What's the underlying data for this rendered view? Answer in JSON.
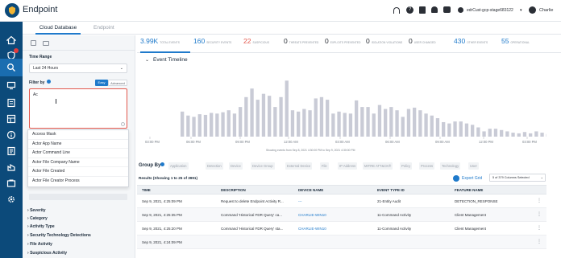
{
  "app": {
    "title": "Endpoint",
    "tenant": "edrCust-gcp-stage683122",
    "user": "Charlie"
  },
  "tabs": [
    {
      "label": "Cloud Database"
    },
    {
      "label": "Endpoint"
    }
  ],
  "sidebar": {
    "time_range_label": "Time Range",
    "time_range_value": "Last 24 Hours",
    "filter_by_label": "Filter by",
    "mode_easy": "Easy",
    "mode_advanced": "Advanced",
    "filter_text": "Ac",
    "dropdown_items": [
      "Access Mask",
      "Actor App Name",
      "Actor Command Line",
      "Actor File Company Name",
      "Actor File Created",
      "Actor File Creator Process"
    ],
    "sections": [
      "Severity",
      "Category",
      "Activity Type",
      "Security Technology Detections",
      "File Activity",
      "Suspicious Activity"
    ]
  },
  "stats": [
    {
      "value": "3.99K",
      "label": "Total Events",
      "color": "#1f7acb"
    },
    {
      "value": "160",
      "label": "Security Events",
      "color": "#1f7acb"
    },
    {
      "value": "22",
      "label": "Suspicious",
      "color": "#e2574c"
    },
    {
      "value": "0",
      "label": "Threats Prevented",
      "color": "#2b2f36"
    },
    {
      "value": "0",
      "label": "Exploits Prevented",
      "color": "#2b2f36"
    },
    {
      "value": "0",
      "label": "Isolation Violations",
      "color": "#2b2f36"
    },
    {
      "value": "0",
      "label": "User Changed",
      "color": "#2b2f36"
    },
    {
      "value": "430",
      "label": "Other Events",
      "color": "#1f7acb"
    },
    {
      "value": "55",
      "label": "Operational",
      "color": "#1f7acb"
    }
  ],
  "timeline": {
    "title": "Event Timeline",
    "caption": "Showing events from Sep 8, 2021 4:30:00 PM to Sep 9, 2021 4:30:00 PM",
    "tick_labels": [
      "03:00 PM",
      "06:00 PM",
      "09:00 PM",
      "12:00 AM",
      "03:00 AM",
      "06:00 AM",
      "09:00 AM",
      "12:00 PM",
      "03:00 PM"
    ],
    "bars": [
      0.38,
      0.32,
      0.3,
      0.34,
      0.33,
      0.36,
      0.35,
      0.37,
      0.4,
      0.35,
      0.45,
      0.6,
      0.73,
      0.56,
      0.65,
      0.62,
      0.45,
      0.6,
      0.85,
      0.4,
      0.38,
      0.42,
      0.4,
      0.58,
      0.6,
      0.56,
      0.35,
      0.38,
      0.36,
      0.35,
      0.55,
      0.45,
      0.45,
      0.35,
      0.48,
      0.42,
      0.45,
      0.4,
      0.3,
      0.42,
      0.44,
      0.4,
      0.35,
      0.32,
      0.28,
      0.22,
      0.2,
      0.23,
      0.23,
      0.2,
      0.18,
      0.14,
      0.08,
      0.12,
      0.12,
      0.1,
      0.08,
      0.06,
      0.05,
      0.07,
      0.05,
      0.08,
      0.06,
      0.04,
      0.05
    ]
  },
  "group_by": {
    "label": "Group By",
    "options": [
      "Application",
      "Detection",
      "Device",
      "Device Group",
      "External Device",
      "File",
      "IP Address",
      "MITRE ATT&CK®",
      "Policy",
      "Process",
      "Technology",
      "User"
    ]
  },
  "results": {
    "summary": "Results (Showing 1 to 25 of 3991)",
    "export_label": "Export Grid",
    "columns_selected": "5 of 379 Columns Selected",
    "columns": [
      "Time",
      "Description",
      "Device Name",
      "Event Type ID",
      "Feature Name"
    ],
    "rows": [
      {
        "time": "Sep 9, 2021, 4:25:09 PM",
        "description": "Request to delete Endpoint Activity R...",
        "device": "---",
        "event_type": "21-Entity Audit",
        "feature": "DETECTION_RESPONSE"
      },
      {
        "time": "Sep 9, 2021, 4:25:35 PM",
        "description": "Command 'Historical FDR Query' ca...",
        "device": "CHARLIE-WIN10",
        "event_type": "11-Command Activity",
        "feature": "Client Management"
      },
      {
        "time": "Sep 9, 2021, 4:25:20 PM",
        "description": "Command 'Historical FDR Query' sta...",
        "device": "CHARLIE-WIN10",
        "event_type": "11-Command Activity",
        "feature": "Client Management"
      },
      {
        "time": "Sep 9, 2021, 4:24:09 PM",
        "description": "",
        "device": "",
        "event_type": "",
        "feature": ""
      }
    ]
  }
}
